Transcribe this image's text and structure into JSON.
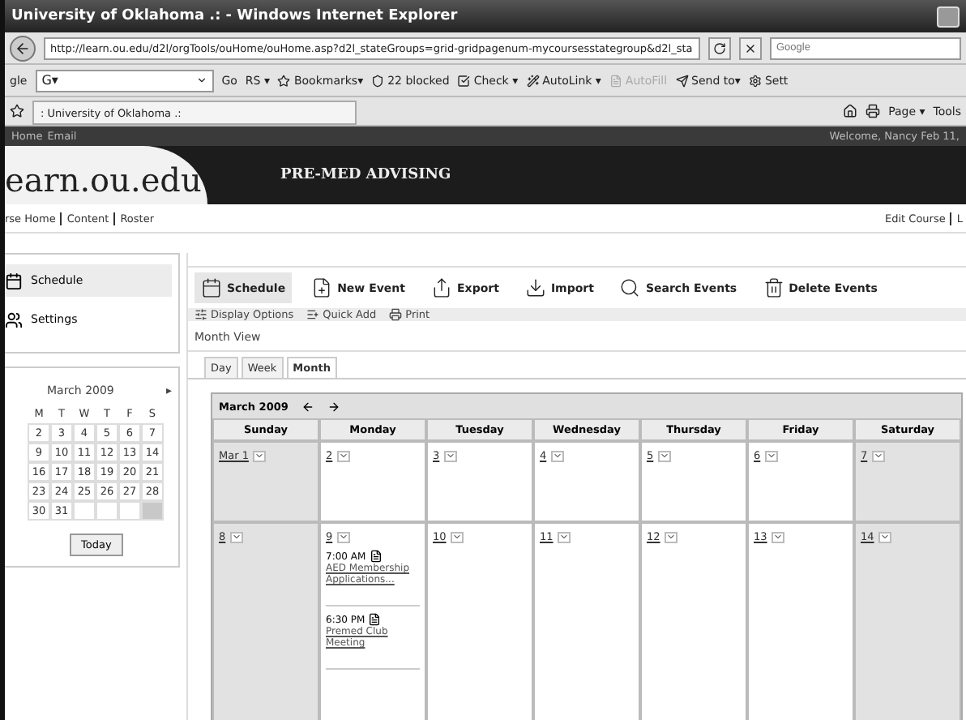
{
  "window": {
    "title": "University of Oklahoma .: - Windows Internet Explorer"
  },
  "address_bar": {
    "url": "http://learn.ou.edu/d2l/orgTools/ouHome/ouHome.asp?d2l_stateGroups=grid-gridpagenum-mycoursesstategroup&d2l_sta",
    "search_placeholder": "Google"
  },
  "google_toolbar": {
    "brand": "gle",
    "field": "G▾",
    "items": [
      {
        "label": "Go",
        "kind": "text",
        "disabled": false
      },
      {
        "label": "RS ▾",
        "kind": "text",
        "disabled": false
      },
      {
        "label": "Bookmarks▾",
        "kind": "star",
        "disabled": false
      },
      {
        "label": "22 blocked",
        "kind": "blocker",
        "disabled": false
      },
      {
        "label": "Check ▾",
        "kind": "check",
        "disabled": false
      },
      {
        "label": "AutoLink ▾",
        "kind": "wand",
        "disabled": false
      },
      {
        "label": "AutoFill",
        "kind": "form",
        "disabled": true
      },
      {
        "label": "Send to▾",
        "kind": "send",
        "disabled": false
      },
      {
        "label": "Sett",
        "kind": "gear",
        "disabled": false
      }
    ]
  },
  "tab_bar": {
    "tab": ": University of Oklahoma .:",
    "right": [
      "Page ▾",
      "Tools"
    ]
  },
  "site": {
    "top_links": [
      "Home",
      "Email"
    ],
    "welcome": "Welcome, Nancy Feb 11,",
    "logo": "earn.ou.edu",
    "course": "PRE-MED ADVISING",
    "nav": [
      "rse Home",
      "Content",
      "Roster"
    ],
    "right_nav": [
      "Edit Course",
      "L"
    ]
  },
  "sidebar": {
    "items": [
      {
        "label": "Schedule",
        "selected": true
      },
      {
        "label": "Settings",
        "selected": false
      }
    ]
  },
  "mini_calendar": {
    "title": "March 2009",
    "next": "▸",
    "weekdays": [
      "M",
      "T",
      "W",
      "T",
      "F",
      "S"
    ],
    "weeks": [
      [
        {
          "day": "2",
          "selected": false
        },
        {
          "day": "3",
          "selected": false
        },
        {
          "day": "4",
          "selected": false
        },
        {
          "day": "5",
          "selected": false
        },
        {
          "day": "6",
          "selected": false
        },
        {
          "day": "7",
          "selected": false
        }
      ],
      [
        {
          "day": "9",
          "selected": false
        },
        {
          "day": "10",
          "selected": false
        },
        {
          "day": "11",
          "selected": false
        },
        {
          "day": "12",
          "selected": false
        },
        {
          "day": "13",
          "selected": false
        },
        {
          "day": "14",
          "selected": false
        }
      ],
      [
        {
          "day": "16",
          "selected": false
        },
        {
          "day": "17",
          "selected": false
        },
        {
          "day": "18",
          "selected": false
        },
        {
          "day": "19",
          "selected": false
        },
        {
          "day": "20",
          "selected": false
        },
        {
          "day": "21",
          "selected": false
        }
      ],
      [
        {
          "day": "23",
          "selected": false
        },
        {
          "day": "24",
          "selected": false
        },
        {
          "day": "25",
          "selected": false
        },
        {
          "day": "26",
          "selected": false
        },
        {
          "day": "27",
          "selected": false
        },
        {
          "day": "28",
          "selected": false
        }
      ],
      [
        {
          "day": "30",
          "selected": false
        },
        {
          "day": "31",
          "selected": false
        },
        {
          "selected": false
        },
        {
          "selected": false
        },
        {
          "selected": false
        },
        {
          "selected": true
        }
      ]
    ],
    "today_button": "Today"
  },
  "toolbar": [
    {
      "label": "Schedule",
      "kind": "schedule",
      "selected": true
    },
    {
      "label": "New Event",
      "kind": "new",
      "selected": false
    },
    {
      "label": "Export",
      "kind": "export",
      "selected": false
    },
    {
      "label": "Import",
      "kind": "import",
      "selected": false
    },
    {
      "label": "Search Events",
      "kind": "search",
      "selected": false
    },
    {
      "label": "Delete Events",
      "kind": "delete",
      "selected": false
    }
  ],
  "subbar": [
    {
      "label": "Display Options",
      "kind": "display"
    },
    {
      "label": "Quick Add",
      "kind": "quick"
    },
    {
      "label": "Print",
      "kind": "print"
    }
  ],
  "view_title": "Month View",
  "view_tabs": [
    {
      "label": "Day",
      "selected": false
    },
    {
      "label": "Week",
      "selected": false
    },
    {
      "label": "Month",
      "selected": true
    }
  ],
  "calendar": {
    "title": "March 2009",
    "columns": [
      {
        "label": "Sunday",
        "weekend": true
      },
      {
        "label": "Monday",
        "weekend": false
      },
      {
        "label": "Tuesday",
        "weekend": false
      },
      {
        "label": "Wednesday",
        "weekend": false
      },
      {
        "label": "Thursday",
        "weekend": false
      },
      {
        "label": "Friday",
        "weekend": false
      },
      {
        "label": "Saturday",
        "weekend": true
      }
    ],
    "weeks": [
      [
        {
          "day": "Mar 1"
        },
        {
          "day": "2"
        },
        {
          "day": "3"
        },
        {
          "day": "4"
        },
        {
          "day": "5"
        },
        {
          "day": "6"
        },
        {
          "day": "7"
        }
      ],
      [
        {
          "day": "8"
        },
        {
          "day": "9",
          "events": [
            {
              "time": "7:00 AM",
              "title": "AED Membership Applications..."
            },
            {
              "time": "6:30 PM",
              "title": "Premed Club Meeting"
            }
          ]
        },
        {
          "day": "10"
        },
        {
          "day": "11"
        },
        {
          "day": "12"
        },
        {
          "day": "13"
        },
        {
          "day": "14"
        }
      ]
    ]
  }
}
